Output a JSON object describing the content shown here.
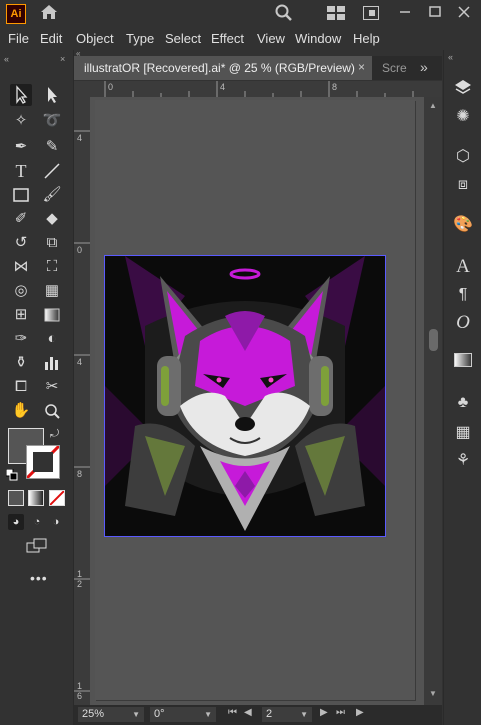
{
  "app": {
    "logo": "Ai"
  },
  "titlebar": {
    "home_icon": "home-icon",
    "search_icon": "search-icon",
    "arrange_icon": "arrange-documents-icon"
  },
  "menu": [
    "File",
    "Edit",
    "Object",
    "Type",
    "Select",
    "Effect",
    "View",
    "Window",
    "Help"
  ],
  "tabs": [
    {
      "label": "illustratOR [Recovered].ai* @ 25 % (RGB/Preview)",
      "active": true
    },
    {
      "label": "Scre",
      "active": false
    }
  ],
  "ruler": {
    "horizontal": [
      "0",
      "4",
      "8"
    ],
    "vertical": [
      "4",
      "0",
      "4",
      "8",
      "1\n2",
      "1\n6"
    ]
  },
  "status": {
    "zoom": "25%",
    "rotation": "0°",
    "artboard": "2"
  },
  "colors": {
    "accent": "#ff9a00",
    "art_magenta": "#c61ad9",
    "art_purple": "#8e1aa8",
    "art_green": "#7ea03a"
  }
}
